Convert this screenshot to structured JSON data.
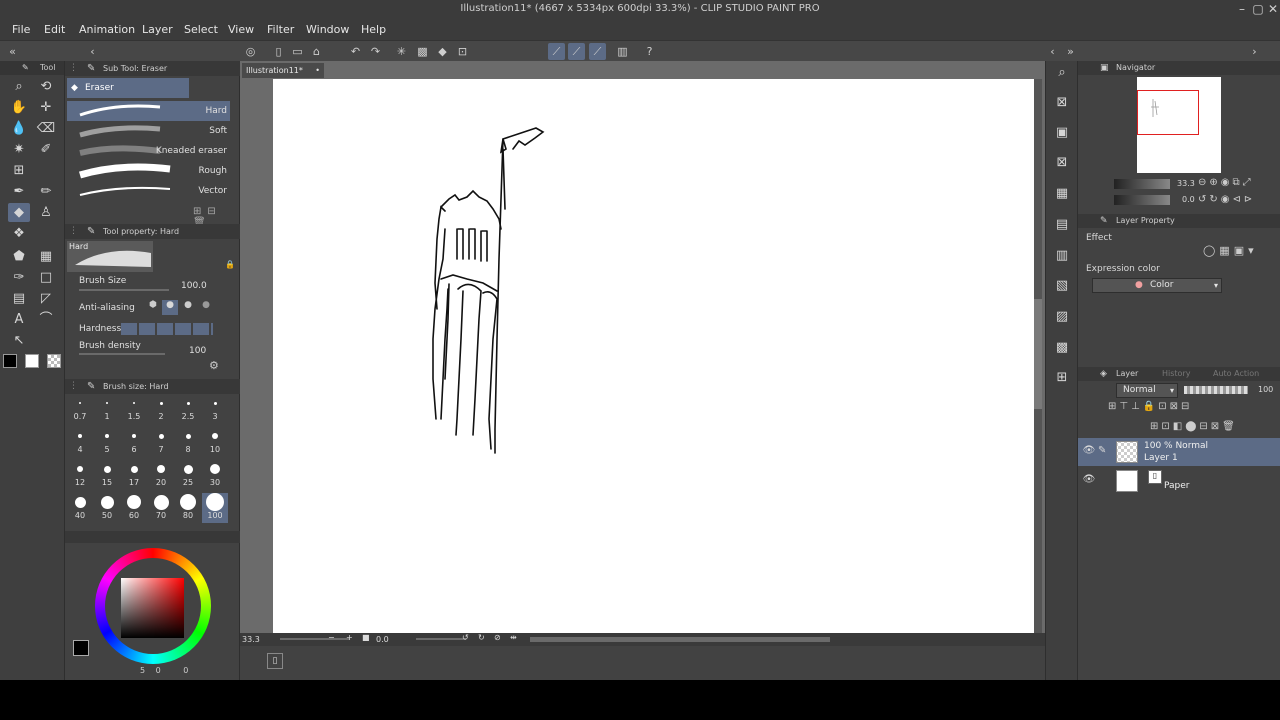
{
  "window": {
    "title": "Illustration11* (4667 x 5334px 600dpi 33.3%)  - CLIP STUDIO PAINT PRO"
  },
  "menu": [
    "File",
    "Edit",
    "Animation",
    "Layer",
    "Select",
    "View",
    "Filter",
    "Window",
    "Help"
  ],
  "tool_panel": {
    "tab": "Tool"
  },
  "sub_tool": {
    "header": "Sub Tool: Eraser",
    "group": "Eraser",
    "brushes": [
      {
        "label": "Hard",
        "selected": true
      },
      {
        "label": "Soft",
        "selected": false
      },
      {
        "label": "Kneaded eraser",
        "selected": false
      },
      {
        "label": "Rough",
        "selected": false
      },
      {
        "label": "Vector",
        "selected": false
      }
    ]
  },
  "tool_property": {
    "header": "Tool property: Hard",
    "preview_label": "Hard",
    "brush_size_label": "Brush Size",
    "brush_size_value": "100.0",
    "antialias_label": "Anti-aliasing",
    "hardness_label": "Hardness",
    "density_label": "Brush density",
    "density_value": "100"
  },
  "brush_size_palette": {
    "header": "Brush size: Hard",
    "sizes": [
      "0.7",
      "1",
      "1.5",
      "2",
      "2.5",
      "3",
      "4",
      "5",
      "6",
      "7",
      "8",
      "10",
      "12",
      "15",
      "17",
      "20",
      "25",
      "30",
      "40",
      "50",
      "60",
      "70",
      "80",
      "100"
    ],
    "selected": "100"
  },
  "color_wheel": {
    "readout": [
      "5",
      "0",
      "0"
    ]
  },
  "document": {
    "tab_label": "Illustration11*"
  },
  "status": {
    "zoom": "33.3",
    "angle": "0.0"
  },
  "navigator": {
    "header": "Navigator",
    "zoom": "33.3",
    "angle": "0.0"
  },
  "layer_property": {
    "header": "Layer Property",
    "effect_label": "Effect",
    "expression_color_label": "Expression color",
    "expression_color_value": "Color"
  },
  "layer_panel": {
    "tabs": [
      "Layer",
      "History",
      "Auto Action"
    ],
    "blend_mode": "Normal",
    "opacity": "100",
    "layers": [
      {
        "line1": "100 % Normal",
        "line2": "Layer 1",
        "selected": true
      },
      {
        "line1": "",
        "line2": "Paper",
        "selected": false
      }
    ]
  },
  "colors": {
    "accent": "#5c6b86",
    "panel": "#424242",
    "menubar": "#3b3b3b",
    "canvas_bg": "#6b6b6b",
    "navigator_frame": "#e02020"
  }
}
